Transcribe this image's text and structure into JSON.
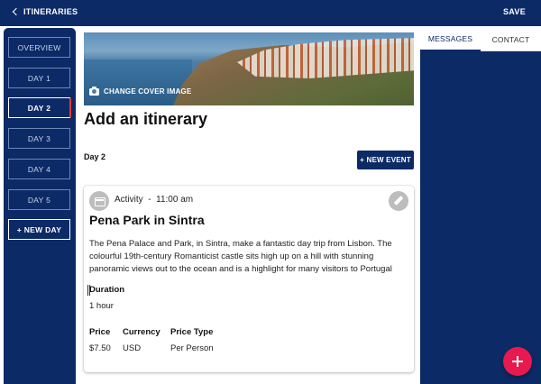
{
  "topbar": {
    "back_label": "ITINERARIES",
    "save_label": "SAVE"
  },
  "sidebar": {
    "items": [
      {
        "label": "OVERVIEW"
      },
      {
        "label": "DAY 1"
      },
      {
        "label": "DAY 2",
        "active": true
      },
      {
        "label": "DAY 3"
      },
      {
        "label": "DAY 4"
      },
      {
        "label": "DAY 5"
      }
    ],
    "new_day_label": "+ NEW DAY"
  },
  "main": {
    "cover_button": "CHANGE COVER IMAGE",
    "title": "Add an itinerary",
    "day_label": "Day 2",
    "new_event_label": "+ NEW EVENT",
    "event": {
      "type": "Activity",
      "separator": "-",
      "time": "11:00 am",
      "title": "Pena Park in Sintra",
      "description": "The Pena Palace and Park, in Sintra, make a fantastic day trip from Lisbon. The colourful 19th-century Romanticist castle sits high up on a hill with stunning panoramic views out to the ocean and is a highlight for many visitors to Portugal",
      "duration_label": "Duration",
      "duration_value": "1 hour",
      "price_label": "Price",
      "price_value": "$7.50",
      "currency_label": "Currency",
      "currency_value": "USD",
      "price_type_label": "Price Type",
      "price_type_value": "Per Person"
    }
  },
  "right_panel": {
    "tabs": [
      {
        "label": "MESSAGES",
        "active": true
      },
      {
        "label": "CONTACT"
      }
    ]
  },
  "colors": {
    "navy": "#0c2a66",
    "fab": "#e8194e",
    "active_marker": "#e53935"
  },
  "icons": [
    "chevron-left-icon",
    "chevron-right-icon",
    "camera-icon",
    "calendar-icon",
    "pencil-icon",
    "plus-icon"
  ]
}
